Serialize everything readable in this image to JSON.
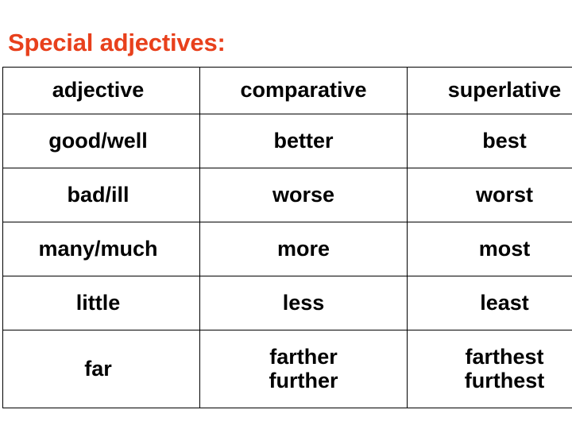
{
  "page_title": "Special adjectives:",
  "colors": {
    "accent_red": "#e8401c",
    "text_black": "#000000",
    "border": "#000000",
    "background": "#ffffff"
  },
  "table": {
    "headers": {
      "adjective": "adjective",
      "comparative": "comparative",
      "superlative": "superlative"
    },
    "rows": [
      {
        "adjective": "good/well",
        "comparative": "better",
        "superlative": "best"
      },
      {
        "adjective": "bad/ill",
        "comparative": "worse",
        "superlative": "worst"
      },
      {
        "adjective": "many/much",
        "comparative": "more",
        "superlative": "most"
      },
      {
        "adjective": "little",
        "comparative": "less",
        "superlative": "least"
      },
      {
        "adjective": "far",
        "comparative_line1": "farther",
        "comparative_line2": "further",
        "superlative_line1": "farthest",
        "superlative_line2": "furthest"
      }
    ]
  }
}
